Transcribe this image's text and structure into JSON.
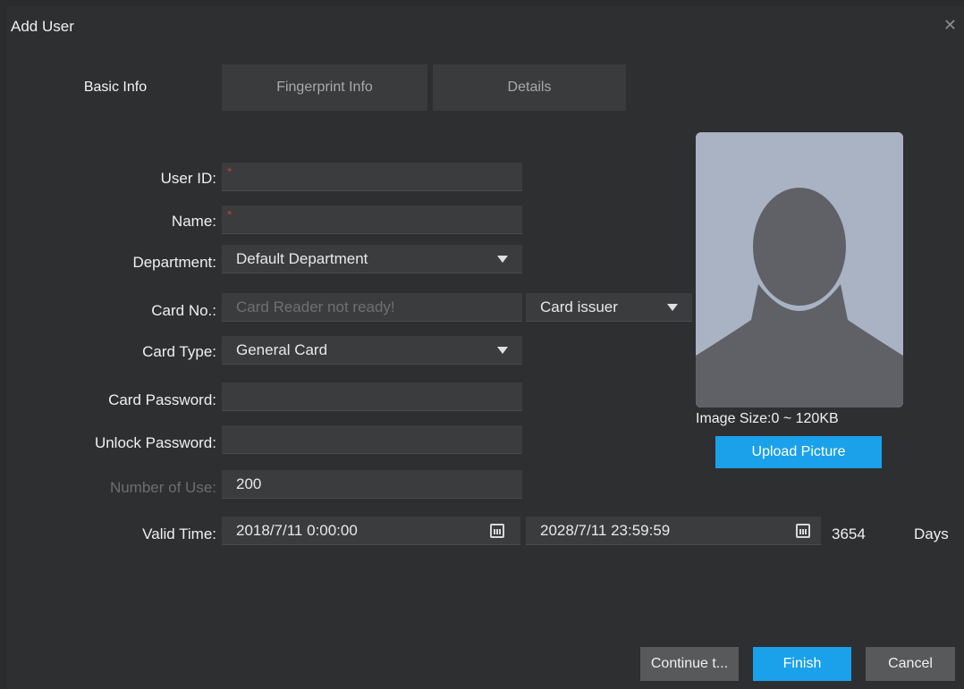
{
  "window": {
    "title": "Add User",
    "close_symbol": "✕"
  },
  "tabs": [
    {
      "label": "Basic Info",
      "active": true
    },
    {
      "label": "Fingerprint Info",
      "active": false
    },
    {
      "label": "Details",
      "active": false
    }
  ],
  "form": {
    "user_id": {
      "label": "User ID:",
      "value": "",
      "required_mark": "*"
    },
    "name": {
      "label": "Name:",
      "value": "",
      "required_mark": "*"
    },
    "department": {
      "label": "Department:",
      "value": "Default Department"
    },
    "card_no": {
      "label": "Card No.:",
      "placeholder": "Card Reader not ready!",
      "issuer": "Card issuer"
    },
    "card_type": {
      "label": "Card Type:",
      "value": "General Card"
    },
    "card_password": {
      "label": "Card Password:",
      "value": ""
    },
    "unlock_password": {
      "label": "Unlock Password:",
      "value": ""
    },
    "number_of_use": {
      "label": "Number of Use:",
      "value": "200",
      "disabled": true
    },
    "valid_time": {
      "label": "Valid Time:",
      "start": "2018/7/11 0:00:00",
      "end": "2028/7/11 23:59:59",
      "days": "3654",
      "days_unit": "Days"
    }
  },
  "photo": {
    "image_size": "Image Size:0 ~ 120KB",
    "upload_label": "Upload Picture"
  },
  "footer": {
    "continue_label": "Continue t...",
    "finish_label": "Finish",
    "cancel_label": "Cancel"
  },
  "colors": {
    "accent": "#1ba1ea",
    "background": "#2e2f31",
    "field": "#3b3c3e",
    "required": "#c53a3a"
  }
}
